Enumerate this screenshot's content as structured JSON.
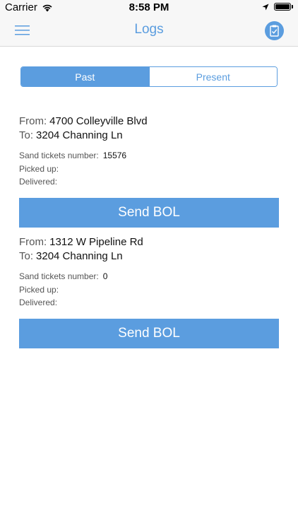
{
  "status_bar": {
    "carrier": "Carrier",
    "time": "8:58 PM"
  },
  "nav": {
    "title": "Logs",
    "menu_icon": "hamburger-menu-icon",
    "right_icon": "clipboard-check-icon"
  },
  "segments": [
    {
      "label": "Past",
      "selected": true
    },
    {
      "label": "Present",
      "selected": false
    }
  ],
  "labels": {
    "from": "From:",
    "to": "To:",
    "sand_tickets": "Sand tickets number:",
    "picked_up": "Picked up:",
    "delivered": "Delivered:"
  },
  "logs": [
    {
      "from": "4700 Colleyville Blvd",
      "to": "3204 Channing Ln",
      "sand_tickets_number": "15576",
      "picked_up": "",
      "delivered": "",
      "button_label": "Send BOL"
    },
    {
      "from": "1312 W Pipeline Rd",
      "to": "3204 Channing Ln",
      "sand_tickets_number": "0",
      "picked_up": "",
      "delivered": "",
      "button_label": "Send BOL"
    }
  ],
  "colors": {
    "accent": "#5b9ddf",
    "bar_background": "#f7f7f7"
  }
}
